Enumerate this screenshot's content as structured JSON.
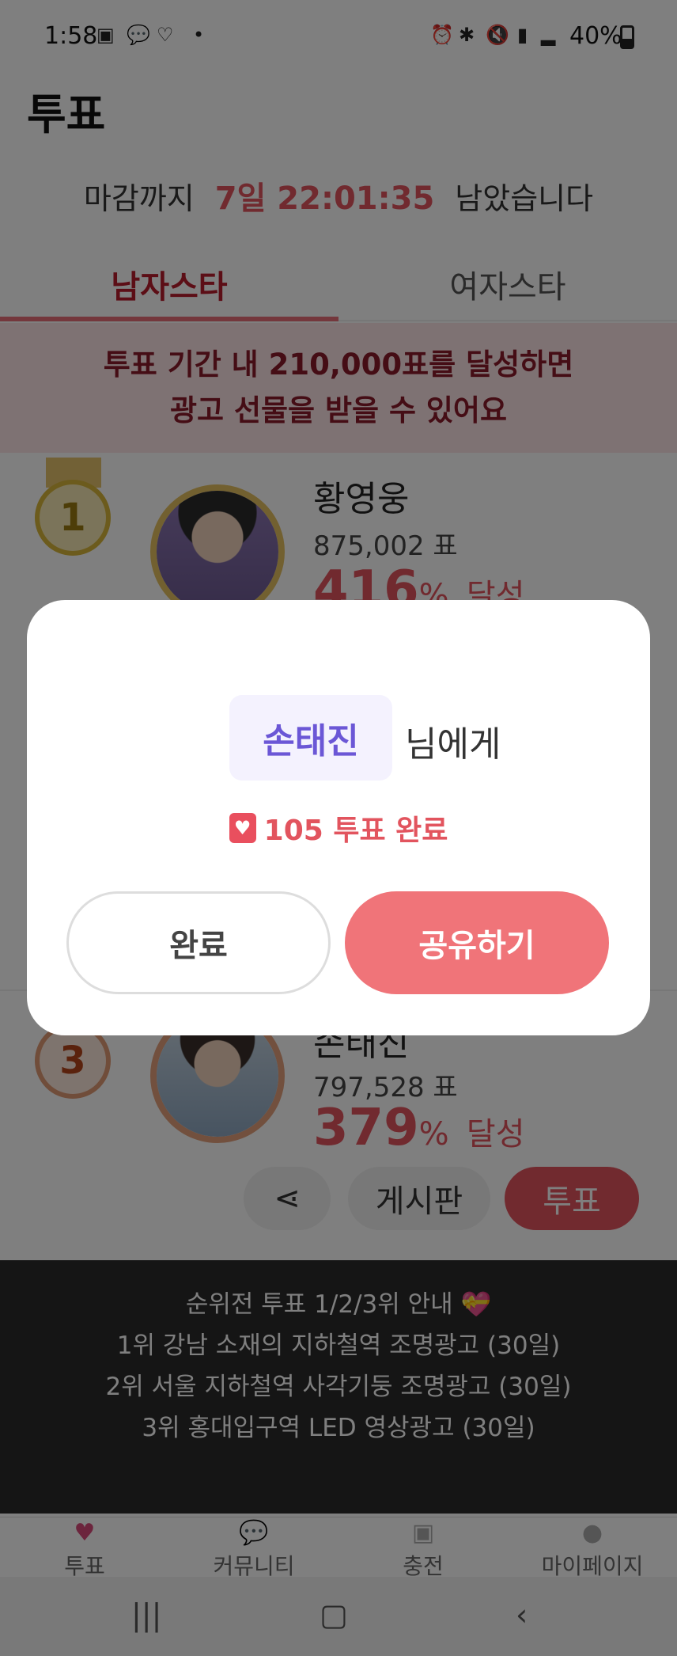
{
  "status": {
    "time": "1:58",
    "battery": "40%"
  },
  "header": {
    "title": "투표"
  },
  "countdown": {
    "prefix": "마감까지",
    "timer": "7일 22:01:35",
    "suffix": "남았습니다"
  },
  "tabs": [
    {
      "label": "남자스타"
    },
    {
      "label": "여자스타"
    }
  ],
  "banner": {
    "line1": "투표 기간 내 210,000표를 달성하면",
    "line2": "광고 선물을 받을 수 있어요"
  },
  "ranking": [
    {
      "rank": "1",
      "name": "황영웅",
      "votes": "875,002 표",
      "pct": "416",
      "pct_unit": "%",
      "pct_label": "달성"
    },
    {
      "rank": "3",
      "name": "손태진",
      "votes": "797,528 표",
      "pct": "379",
      "pct_unit": "%",
      "pct_label": "달성"
    }
  ],
  "row_buttons": {
    "board": "게시판",
    "vote": "투표"
  },
  "info": {
    "line1": "순위전 투표 1/2/3위 안내 💝",
    "line2": "1위 강남 소재의 지하철역 조명광고 (30일)",
    "line3": "2위 서울 지하철역 사각기둥 조명광고 (30일)",
    "line4": "3위 홍대입구역 LED 영상광고 (30일)"
  },
  "bottom_nav": [
    {
      "label": "투표",
      "icon": "vote-heart-icon"
    },
    {
      "label": "커뮤니티",
      "icon": "chat-bubbles-icon"
    },
    {
      "label": "충전",
      "icon": "charge-box-icon"
    },
    {
      "label": "마이페이지",
      "icon": "person-icon"
    }
  ],
  "modal": {
    "recipient": "손태진",
    "recipient_suffix": "님에게",
    "result": "105 투표 완료",
    "done_label": "완료",
    "share_label": "공유하기"
  },
  "colors": {
    "accent": "#e2545e",
    "modal_purple": "#6b57d6",
    "share_button": "#f07479"
  }
}
